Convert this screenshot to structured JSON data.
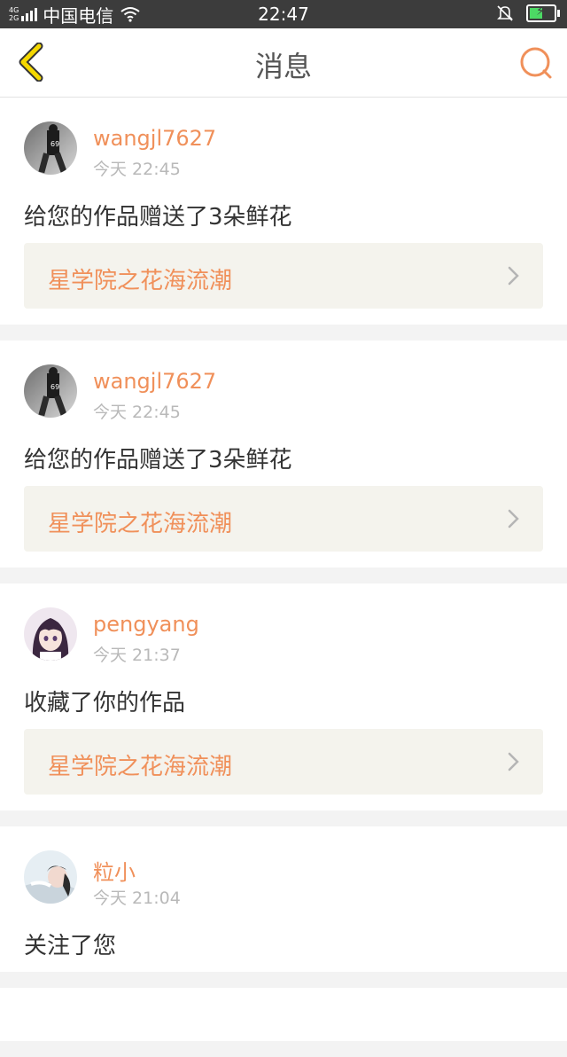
{
  "status_bar": {
    "network_top": "4G",
    "network_bottom": "2G",
    "carrier": "中国电信",
    "time": "22:47",
    "battery_level": 0.55,
    "battery_color": "#4cd964"
  },
  "nav": {
    "title": "消息",
    "back_icon": "chevron-left-icon",
    "search_icon": "search-icon"
  },
  "colors": {
    "accent": "#f0905a",
    "back_icon_color": "#f5d800",
    "link_bg": "#f4f3ed"
  },
  "messages": [
    {
      "username": "wangjl7627",
      "time": "今天 22:45",
      "text": "给您的作品赠送了3朵鲜花",
      "work_title": "星学院之花海流潮"
    },
    {
      "username": "wangjl7627",
      "time": "今天 22:45",
      "text": "给您的作品赠送了3朵鲜花",
      "work_title": "星学院之花海流潮"
    },
    {
      "username": "pengyang",
      "time": "今天 21:37",
      "text": "收藏了你的作品",
      "work_title": "星学院之花海流潮"
    },
    {
      "username": "粒小",
      "time": "今天 21:04",
      "text": "关注了您",
      "work_title": null
    }
  ]
}
